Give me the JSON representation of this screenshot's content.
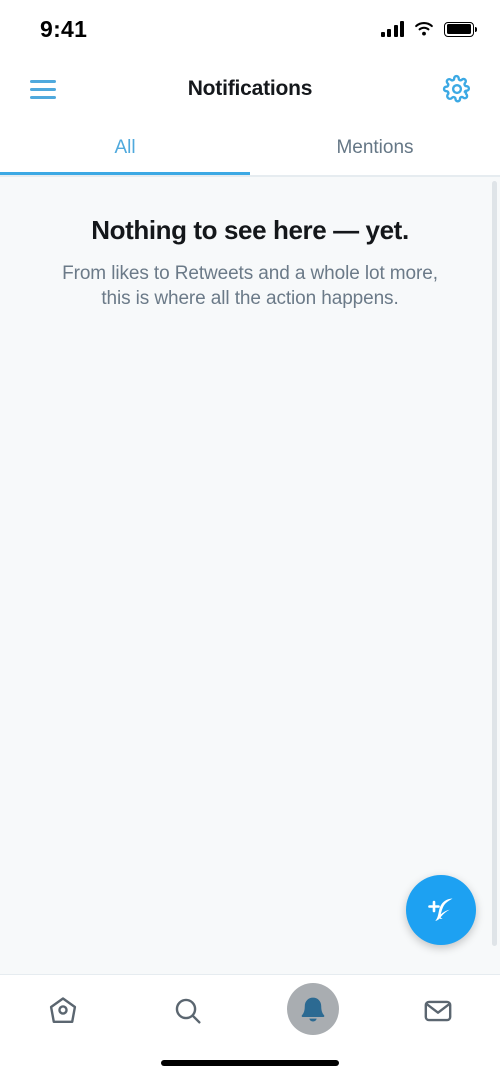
{
  "status_bar": {
    "time": "9:41",
    "signal_icon": "cellular-signal-icon",
    "wifi_icon": "wifi-icon",
    "battery_icon": "battery-full-icon"
  },
  "header": {
    "menu_icon": "hamburger-menu-icon",
    "title": "Notifications",
    "settings_icon": "gear-icon"
  },
  "tabs": {
    "items": [
      {
        "label": "All",
        "active": true
      },
      {
        "label": "Mentions",
        "active": false
      }
    ],
    "active_color": "#3CA9E4",
    "inactive_color": "#657786"
  },
  "empty_state": {
    "title": "Nothing to see here — yet.",
    "subtitle_line1": "From likes to Retweets and a whole lot more,",
    "subtitle_line2": "this is where all the action happens."
  },
  "compose": {
    "icon": "compose-feather-plus-icon",
    "color": "#1DA1F2"
  },
  "bottom_nav": {
    "items": [
      {
        "name": "home",
        "icon": "home-birdhouse-icon",
        "active": false
      },
      {
        "name": "search",
        "icon": "search-magnifier-icon",
        "active": false
      },
      {
        "name": "notifications",
        "icon": "bell-icon",
        "active": true
      },
      {
        "name": "messages",
        "icon": "envelope-icon",
        "active": false
      }
    ],
    "icon_color": "#5b6670",
    "active_bell_color": "#2c6a92"
  },
  "home_indicator": {
    "name": "home-indicator-bar"
  }
}
